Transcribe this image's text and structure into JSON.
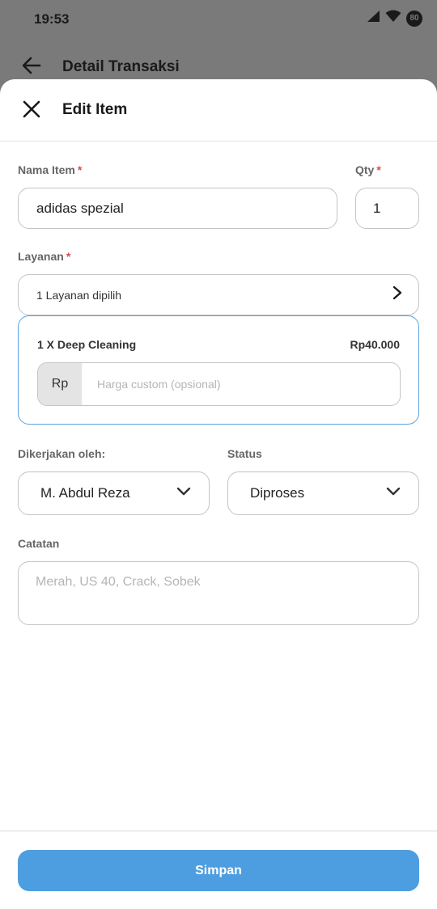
{
  "status_bar": {
    "time": "19:53",
    "battery": "80"
  },
  "background_header": {
    "title": "Detail Transaksi"
  },
  "sheet": {
    "title": "Edit Item",
    "item_name": {
      "label": "Nama Item",
      "required": "*",
      "value": "adidas spezial"
    },
    "qty": {
      "label": "Qty",
      "required": "*",
      "value": "1"
    },
    "service": {
      "label": "Layanan",
      "required": "*",
      "selector_text": "1 Layanan dipilih",
      "selected": {
        "name": "1 X Deep Cleaning",
        "price": "Rp40.000"
      },
      "custom_price": {
        "prefix": "Rp",
        "placeholder": "Harga custom (opsional)"
      }
    },
    "worker": {
      "label": "Dikerjakan oleh:",
      "value": "M. Abdul Reza"
    },
    "status": {
      "label": "Status",
      "value": "Diproses"
    },
    "notes": {
      "label": "Catatan",
      "placeholder": "Merah, US 40, Crack, Sobek"
    },
    "save_label": "Simpan"
  },
  "colors": {
    "accent": "#4d9ee0",
    "required": "#e04848",
    "card_border": "#5aa2dc"
  }
}
